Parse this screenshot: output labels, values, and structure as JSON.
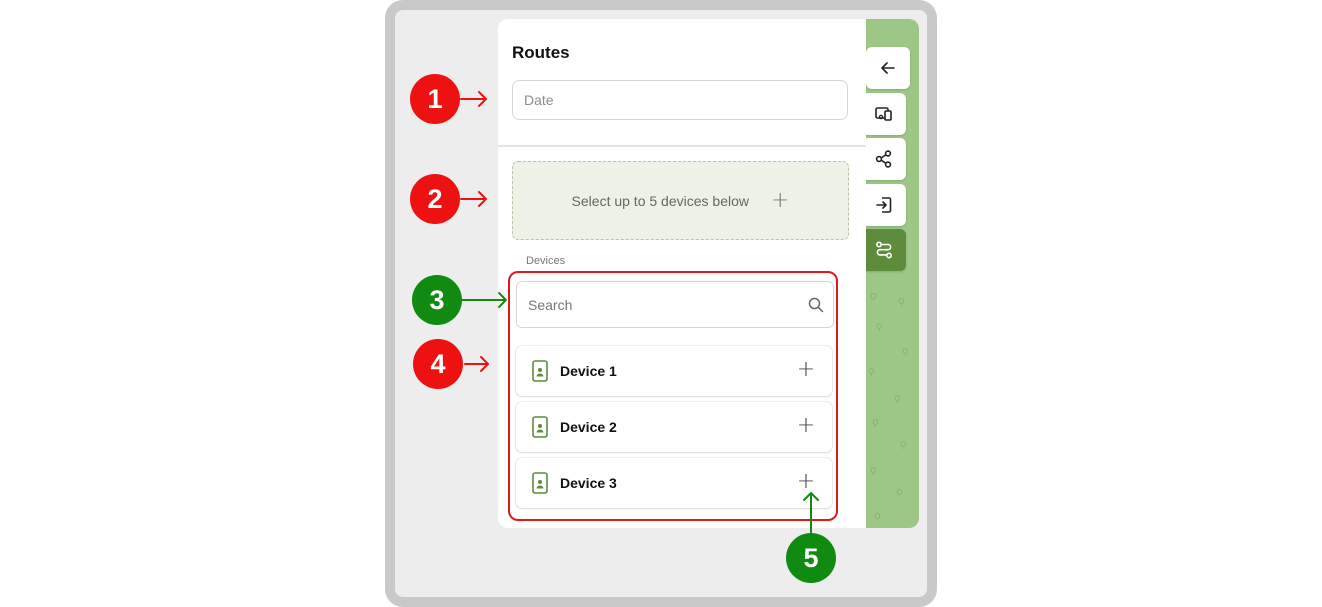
{
  "panel": {
    "title": "Routes",
    "date_placeholder": "Date",
    "dropzone_text": "Select up to 5 devices below",
    "dropzone_plus": "+",
    "devices_label": "Devices",
    "search_placeholder": "Search",
    "devices": [
      {
        "name": "Device 1",
        "add": "+"
      },
      {
        "name": "Device 2",
        "add": "+"
      },
      {
        "name": "Device 3",
        "add": "+"
      }
    ]
  },
  "toolbar": {
    "buttons": [
      {
        "icon": "arrow-left-icon"
      },
      {
        "icon": "devices-icon"
      },
      {
        "icon": "share-nodes-icon"
      },
      {
        "icon": "login-icon"
      },
      {
        "icon": "route-icon",
        "active": true
      }
    ]
  },
  "annotations": {
    "badges": [
      {
        "label": "1",
        "color": "#ee1111"
      },
      {
        "label": "2",
        "color": "#ee1111"
      },
      {
        "label": "3",
        "color": "#108a10"
      },
      {
        "label": "4",
        "color": "#ee1111"
      },
      {
        "label": "5",
        "color": "#108a10"
      }
    ]
  },
  "colors": {
    "accent": "#5c8c3c",
    "map": "#9cc787",
    "highlight_box": "#e01818"
  }
}
